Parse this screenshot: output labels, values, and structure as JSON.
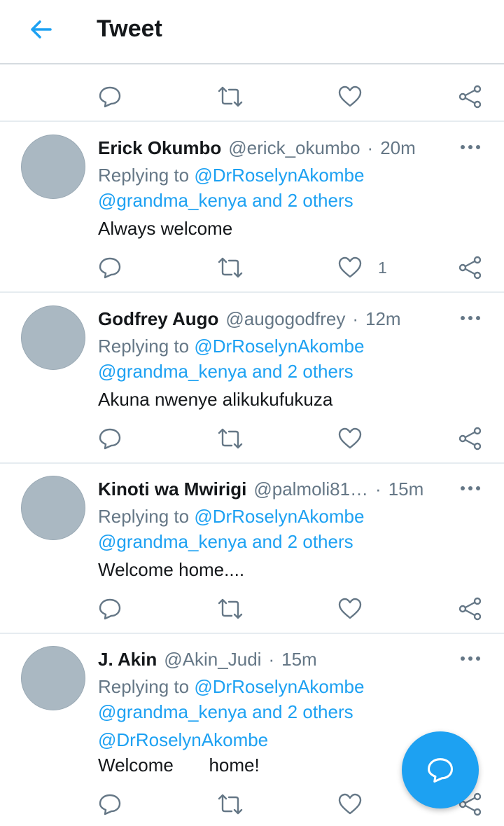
{
  "header": {
    "title": "Tweet"
  },
  "colors": {
    "accent": "#1da1f2",
    "secondary_text": "#657786",
    "avatar": "#aab8c2"
  },
  "icons": {
    "back": "arrow-left-icon",
    "reply": "comment-bubble-icon",
    "retweet": "retweet-icon",
    "like": "heart-icon",
    "share": "share-icon",
    "more": "more-dots-icon",
    "compose": "compose-reply-icon"
  },
  "tweets": [
    {
      "name": "Erick Okumbo",
      "handle": "@erick_okumbo",
      "separator": "·",
      "time": "20m",
      "replying_prefix": "Replying to",
      "replying_first": "@DrRoselynAkombe",
      "replying_second": "@grandma_kenya and 2 others",
      "text": "Always welcome",
      "likes": "1"
    },
    {
      "name": "Godfrey Augo",
      "handle": "@augogodfrey",
      "separator": "·",
      "time": "12m",
      "replying_prefix": "Replying to",
      "replying_first": "@DrRoselynAkombe",
      "replying_second": "@grandma_kenya and 2 others",
      "text": "Akuna nwenye alikukufukuza"
    },
    {
      "name": "Kinoti wa Mwirigi",
      "handle": "@palmoli81…",
      "separator": "·",
      "time": "15m",
      "replying_prefix": "Replying to",
      "replying_first": "@DrRoselynAkombe",
      "replying_second": "@grandma_kenya and 2 others",
      "text": "Welcome home...."
    },
    {
      "name": "J. Akin",
      "handle": "@Akin_Judi",
      "separator": "·",
      "time": "15m",
      "replying_prefix": "Replying to",
      "replying_first": "@DrRoselynAkombe",
      "replying_second": "@grandma_kenya and 2 others",
      "mention": "@DrRoselynAkombe",
      "text": "Welcome       home!"
    }
  ]
}
